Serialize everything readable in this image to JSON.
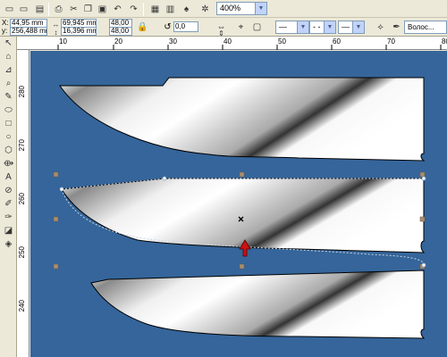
{
  "property_bar": {
    "x_label": "X:",
    "x_value": "44,95 mm",
    "y_label": "y:",
    "y_value": "256,488 mm",
    "width_value": "69,945 mm",
    "height_value": "16,396 mm",
    "scale_x": "48,00",
    "scale_y": "48,00",
    "zoom": "400%",
    "rotation": "0,0",
    "outline_style_1": "—",
    "outline_style_2": "- -",
    "outline_width": "Волос..."
  },
  "ruler_h": [
    "10",
    "20",
    "30",
    "40",
    "50",
    "60",
    "70",
    "80"
  ],
  "ruler_v": [
    "280",
    "270",
    "260",
    "250",
    "240"
  ],
  "colors": {
    "canvas": "#35659a",
    "arrow": "#cc1111",
    "handle": "#8b7355"
  }
}
